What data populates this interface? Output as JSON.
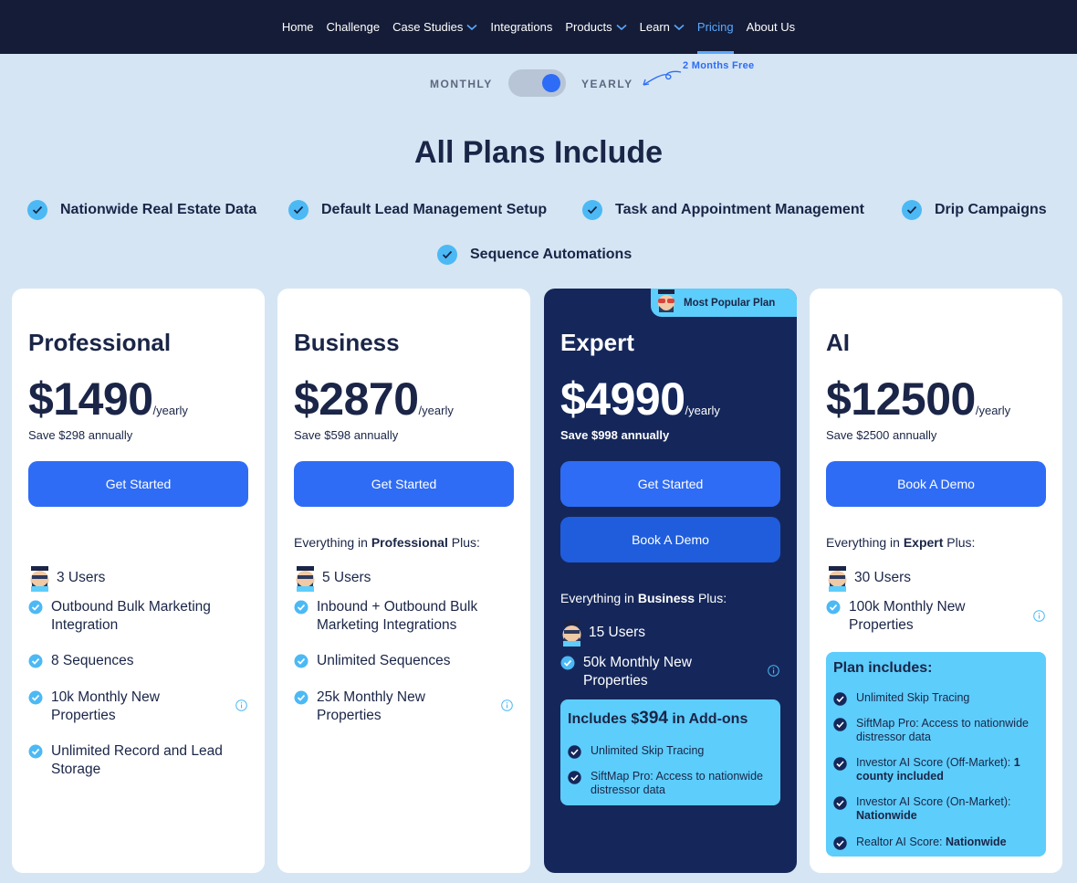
{
  "nav": {
    "items": [
      {
        "label": "Home",
        "dropdown": false,
        "active": false
      },
      {
        "label": "Challenge",
        "dropdown": false,
        "active": false
      },
      {
        "label": "Case Studies",
        "dropdown": true,
        "active": false
      },
      {
        "label": "Integrations",
        "dropdown": false,
        "active": false
      },
      {
        "label": "Products",
        "dropdown": true,
        "active": false
      },
      {
        "label": "Learn",
        "dropdown": true,
        "active": false
      },
      {
        "label": "Pricing",
        "dropdown": false,
        "active": true
      },
      {
        "label": "About Us",
        "dropdown": false,
        "active": false
      }
    ]
  },
  "billing": {
    "monthly_label": "MONTHLY",
    "yearly_label": "YEARLY",
    "selected": "yearly",
    "free_note": "2 Months Free"
  },
  "includes": {
    "title": "All Plans Include",
    "items": [
      "Nationwide Real Estate Data",
      "Default Lead Management Setup",
      "Task and Appointment Management",
      "Drip Campaigns",
      "Sequence Automations"
    ]
  },
  "colors": {
    "nav_bg": "#141c37",
    "page_bg": "#d5e5f3",
    "accent": "#2f6cf5",
    "dark_card": "#15275a",
    "highlight": "#5dcdfb"
  },
  "plans": {
    "professional": {
      "name": "Professional",
      "price": "$1490",
      "period": "/yearly",
      "save": "Save $298 annually",
      "cta": "Get Started",
      "users": "3 Users",
      "features": [
        "Outbound Bulk Marketing Integration",
        "8 Sequences",
        "10k Monthly New Properties",
        "Unlimited Record and Lead Storage"
      ]
    },
    "business": {
      "name": "Business",
      "price": "$2870",
      "period": "/yearly",
      "save": "Save $598 annually",
      "cta": "Get Started",
      "everything_prefix": "Everything in ",
      "everything_plan": "Professional",
      "everything_suffix": " Plus:",
      "users": "5 Users",
      "features": [
        "Inbound + Outbound Bulk Marketing Integrations",
        "Unlimited Sequences",
        "25k Monthly New Properties"
      ]
    },
    "expert": {
      "badge": "Most Popular Plan",
      "name": "Expert",
      "price": "$4990",
      "period": "/yearly",
      "save": "Save $998 annually",
      "cta": "Get Started",
      "cta2": "Book A Demo",
      "everything_prefix": "Everything in ",
      "everything_plan": "Business",
      "everything_suffix": " Plus:",
      "users": "15 Users",
      "features": [
        "50k Monthly New Properties"
      ],
      "addons_prefix": "Includes $",
      "addons_amount": "394",
      "addons_suffix": " in Add-ons",
      "addons": [
        "Unlimited Skip Tracing",
        "SiftMap Pro: Access to nationwide distressor data"
      ]
    },
    "ai": {
      "name": "AI",
      "price": "$12500",
      "period": "/yearly",
      "save": "Save $2500 annually",
      "cta": "Book A Demo",
      "everything_prefix": "Everything in ",
      "everything_plan": "Expert",
      "everything_suffix": " Plus:",
      "users": "30 Users",
      "features": [
        "100k Monthly New Properties"
      ],
      "includes_title": "Plan includes:",
      "includes": [
        {
          "text": "Unlimited Skip Tracing",
          "bold": ""
        },
        {
          "text": "SiftMap Pro: Access to nationwide distressor data",
          "bold": ""
        },
        {
          "text": "Investor AI Score (Off-Market): ",
          "bold": "1 county included"
        },
        {
          "text": "Investor AI Score (On-Market): ",
          "bold": "Nationwide"
        },
        {
          "text": "Realtor AI Score: ",
          "bold": "Nationwide"
        }
      ]
    }
  }
}
